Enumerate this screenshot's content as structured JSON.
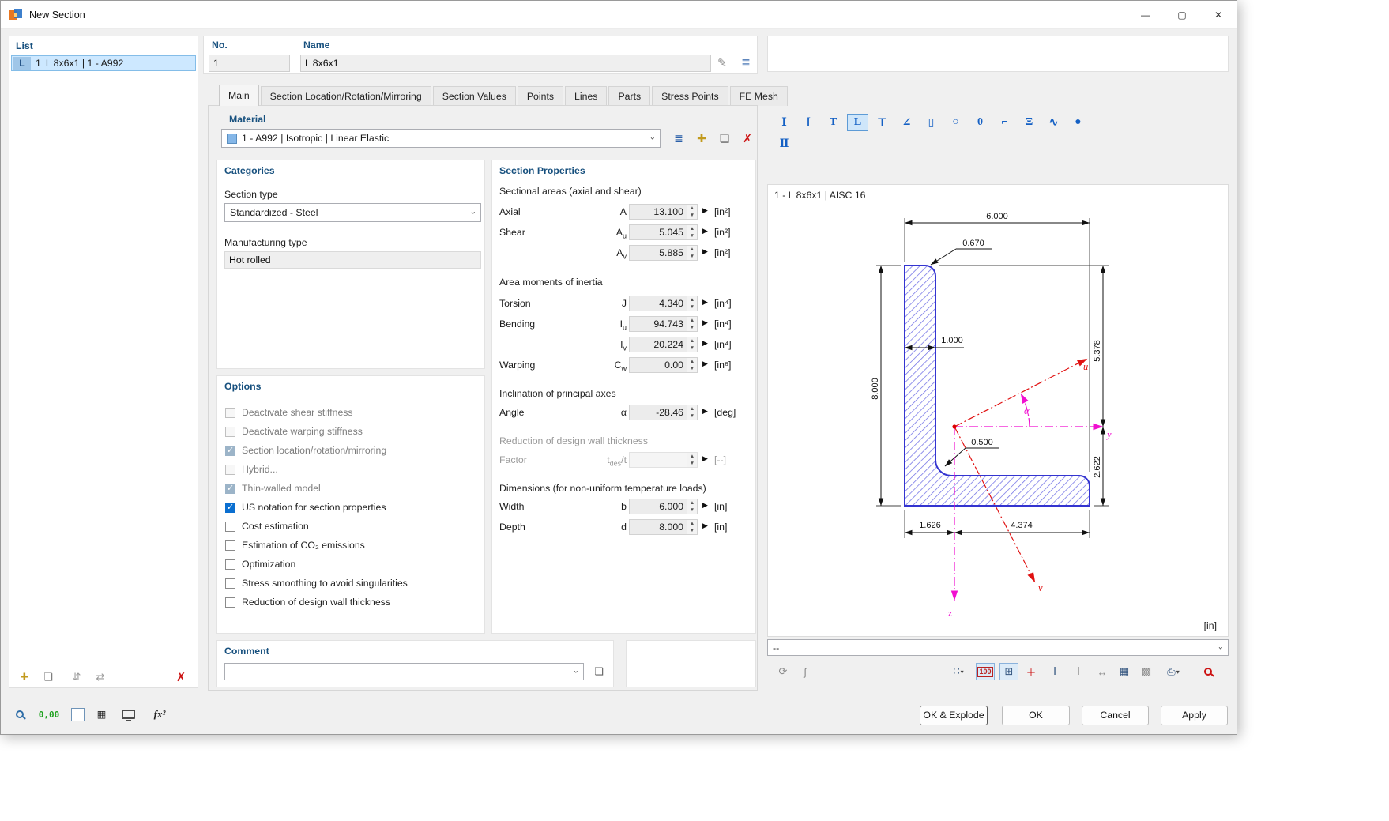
{
  "window": {
    "title": "New Section"
  },
  "list": {
    "label": "List",
    "item_icon": "L",
    "item_no": "1",
    "item_name": "L 8x6x1 | 1 - A992"
  },
  "header": {
    "no_label": "No.",
    "no_value": "1",
    "name_label": "Name",
    "name_value": "L 8x6x1"
  },
  "tabs": [
    "Main",
    "Section Location/Rotation/Mirroring",
    "Section Values",
    "Points",
    "Lines",
    "Parts",
    "Stress Points",
    "FE Mesh"
  ],
  "material": {
    "label": "Material",
    "value": "1 - A992 | Isotropic | Linear Elastic",
    "swatch_color": "#85b7e8"
  },
  "categories": {
    "title": "Categories",
    "type_label": "Section type",
    "type_value": "Standardized - Steel",
    "mfg_label": "Manufacturing type",
    "mfg_value": "Hot rolled"
  },
  "options": {
    "title": "Options",
    "items": [
      {
        "label": "Deactivate shear stiffness",
        "state": "disabled-unchecked"
      },
      {
        "label": "Deactivate warping stiffness",
        "state": "disabled-unchecked"
      },
      {
        "label": "Section location/rotation/mirroring",
        "state": "disabled-checked"
      },
      {
        "label": "Hybrid...",
        "state": "disabled-unchecked"
      },
      {
        "label": "Thin-walled model",
        "state": "disabled-checked"
      },
      {
        "label": "US notation for section properties",
        "state": "checked"
      },
      {
        "label": "Cost estimation",
        "state": "unchecked"
      },
      {
        "label": "Estimation of CO₂ emissions",
        "state": "unchecked"
      },
      {
        "label": "Optimization",
        "state": "unchecked"
      },
      {
        "label": "Stress smoothing to avoid singularities",
        "state": "unchecked"
      },
      {
        "label": "Reduction of design wall thickness",
        "state": "unchecked"
      }
    ]
  },
  "props": {
    "title": "Section Properties",
    "h_areas": "Sectional areas (axial and shear)",
    "h_inertia": "Area moments of inertia",
    "h_incl": "Inclination of principal axes",
    "h_reduction": "Reduction of design wall thickness",
    "h_dims": "Dimensions (for non-uniform temperature loads)",
    "rows": [
      {
        "label": "Axial",
        "sym": "A",
        "sub": "",
        "value": "13.100",
        "unit": "[in²]"
      },
      {
        "label": "Shear",
        "sym": "A",
        "sub": "u",
        "value": "5.045",
        "unit": "[in²]"
      },
      {
        "label": "",
        "sym": "A",
        "sub": "v",
        "value": "5.885",
        "unit": "[in²]"
      },
      {
        "label": "Torsion",
        "sym": "J",
        "sub": "",
        "value": "4.340",
        "unit": "[in⁴]"
      },
      {
        "label": "Bending",
        "sym": "I",
        "sub": "u",
        "value": "94.743",
        "unit": "[in⁴]"
      },
      {
        "label": "",
        "sym": "I",
        "sub": "v",
        "value": "20.224",
        "unit": "[in⁴]"
      },
      {
        "label": "Warping",
        "sym": "C",
        "sub": "w",
        "value": "0.00",
        "unit": "[in⁶]"
      },
      {
        "label": "Angle",
        "sym": "α",
        "sub": "",
        "value": "-28.46",
        "unit": "[deg]"
      },
      {
        "label": "Factor",
        "sym": "t",
        "sub": "des",
        "rest": "/t",
        "value": "",
        "unit": "[--]"
      },
      {
        "label": "Width",
        "sym": "b",
        "sub": "",
        "value": "6.000",
        "unit": "[in]"
      },
      {
        "label": "Depth",
        "sym": "d",
        "sub": "",
        "value": "8.000",
        "unit": "[in]"
      }
    ]
  },
  "comment": {
    "title": "Comment",
    "value": ""
  },
  "right": {
    "caption": "1 - L 8x6x1 | AISC 16",
    "unit_note": "[in]",
    "combo_value": "--",
    "icons1": [
      "Ⅰ",
      "[",
      "T",
      "L",
      "⊤",
      "∠",
      "▯",
      "○",
      "0",
      "⌐",
      "Ξ",
      "∿",
      "●"
    ],
    "icons2": [
      "Ⅱ"
    ]
  },
  "drawing": {
    "dims": {
      "width": "6.000",
      "toe_radius": "0.670",
      "thickness": "1.000",
      "depth": "8.000",
      "above_axis": "5.378",
      "below_axis": "2.622",
      "left_of_axis": "1.626",
      "right_of_axis": "4.374",
      "fillet": "0.500"
    },
    "axes": {
      "y": "y",
      "z": "z",
      "u": "u",
      "v": "v",
      "alpha": "α"
    }
  },
  "footer": {
    "ok_explode": "OK & Explode",
    "ok": "OK",
    "cancel": "Cancel",
    "apply": "Apply",
    "values_btn": "0,00",
    "fx_btn": "fx²"
  },
  "icons": {
    "minimize": "—",
    "maximize": "▢",
    "close": "✕",
    "edit": "✎",
    "library": "≣",
    "new": "✚",
    "props": "❏",
    "delete": "✗",
    "copy": "❏",
    "sort1": "⇵",
    "sort2": "⇄",
    "tb_sync": "⟳",
    "tb_integral": "∫",
    "tb_points": "∷",
    "tb_num": "100",
    "tb_grid": "⊞",
    "tb_axes": "＋",
    "tb_i": "Ⅰ",
    "tb_dim": "↔",
    "tb_table": "▦",
    "tb_mesh": "▩",
    "tb_print": "⎙",
    "tb_dd": "▾"
  }
}
